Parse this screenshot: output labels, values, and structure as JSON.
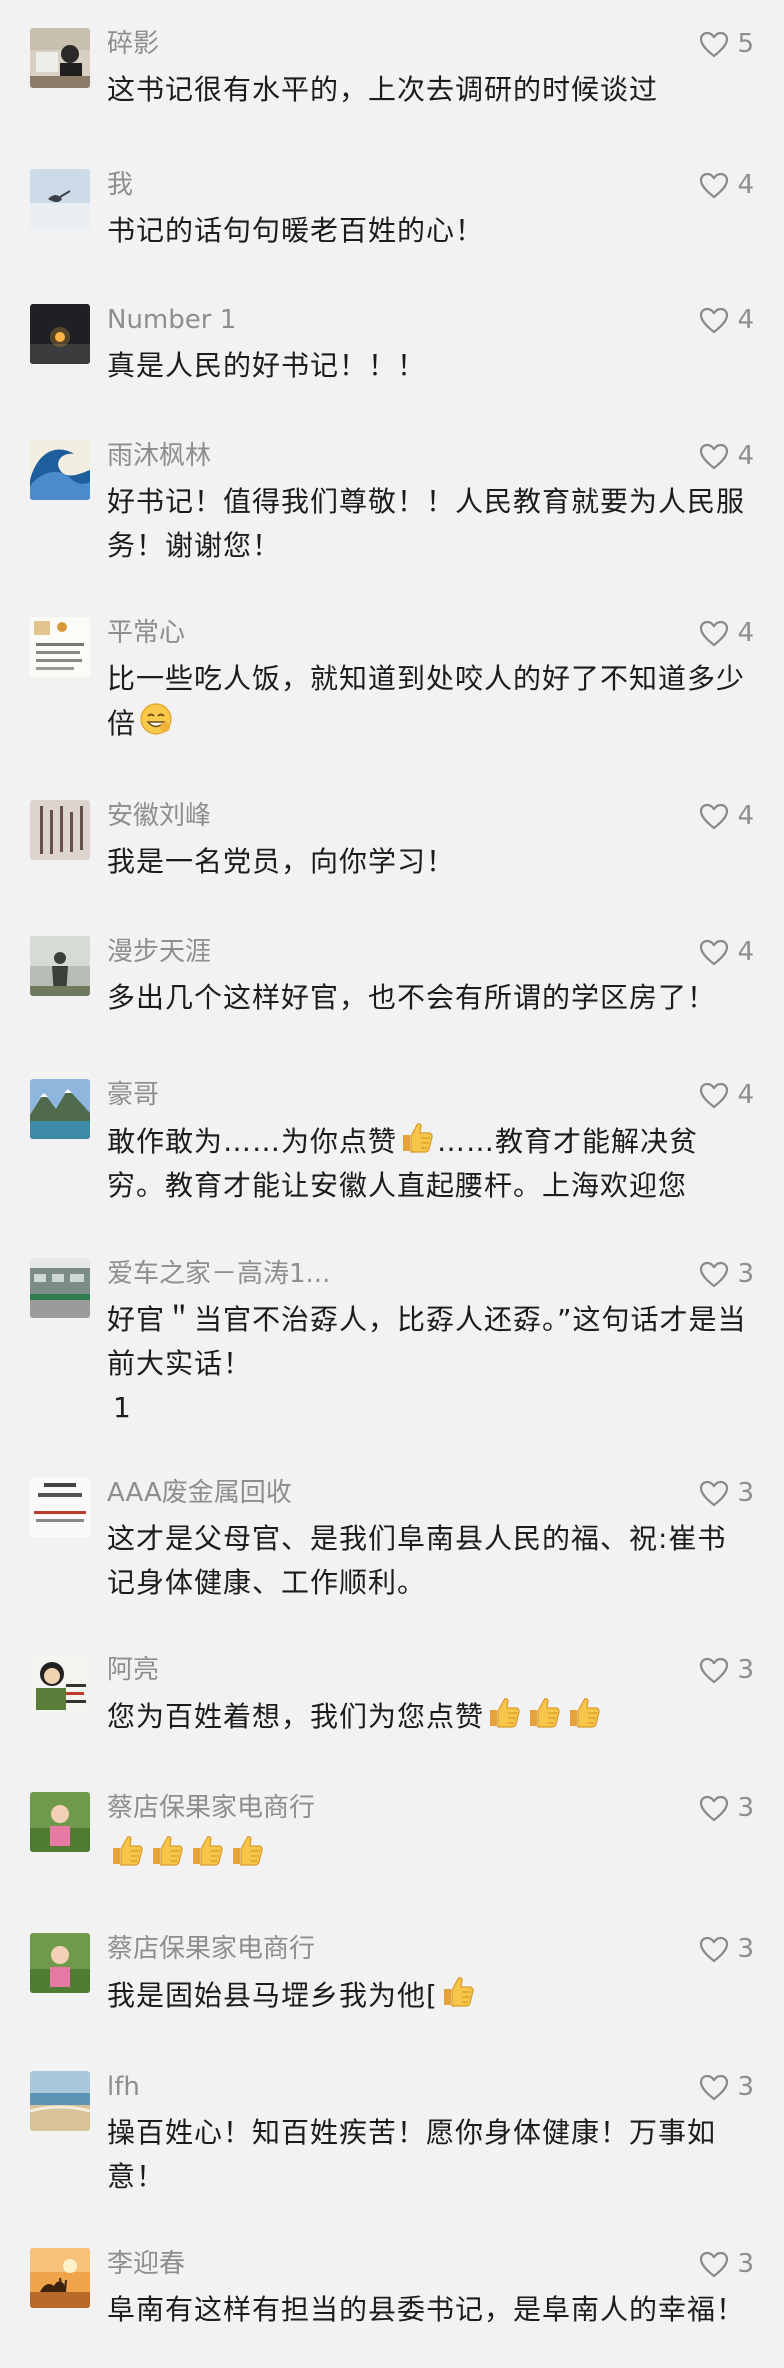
{
  "comments": [
    {
      "name": "碎影",
      "likes": "5",
      "text": "这书记很有水平的，上次去调研的时候谈过",
      "avatar": "avatar-photo-office"
    },
    {
      "name": "我",
      "likes": "4",
      "text": "书记的话句句暖老百姓的心！",
      "avatar": "avatar-sky-bird"
    },
    {
      "name": "Number 1",
      "likes": "4",
      "text": "真是人民的好书记！！！",
      "avatar": "avatar-dark-candle"
    },
    {
      "name": "雨沐枫林",
      "likes": "4",
      "text": "好书记！值得我们尊敬！！人民教育就要为人民服务！谢谢您！",
      "avatar": "avatar-wave"
    },
    {
      "name": "平常心",
      "likes": "4",
      "text": "比一些吃人饭，就知道到处咬人的好了不知道多少倍",
      "avatar": "avatar-text-card",
      "emoji": "grin-face-emoji"
    },
    {
      "name": "安徽刘峰",
      "likes": "4",
      "text": "我是一名党员，向你学习！",
      "avatar": "avatar-calligraphy"
    },
    {
      "name": "漫步天涯",
      "likes": "4",
      "text": "多出几个这样好官，也不会有所谓的学区房了！",
      "avatar": "avatar-person-silhouette"
    },
    {
      "name": "豪哥",
      "likes": "4",
      "text_parts": [
        "敢作敢为……为你点赞",
        "……教育才能解决贫穷。教育才能让安徽人直起腰杆。上海欢迎您"
      ],
      "avatar": "avatar-mountain-lake"
    },
    {
      "name": "爱车之家－高涛1...",
      "likes": "3",
      "text": "好官＂当官不治孬人，比孬人还孬。”这句话才是当前大实话！",
      "text_extra": "1",
      "avatar": "avatar-storefront"
    },
    {
      "name": "AAA废金属回收",
      "likes": "3",
      "text": "这才是父母官、是我们阜南县人民的福、祝:崔书记身体健康、工作顺利。",
      "avatar": "avatar-text-card-2"
    },
    {
      "name": "阿亮",
      "likes": "3",
      "text": "您为百姓着想，我们为您点赞",
      "thumbs_after": 3,
      "avatar": "avatar-cartoon"
    },
    {
      "name": "蔡店保果家电商行",
      "likes": "3",
      "text": "",
      "thumbs_after": 4,
      "avatar": "avatar-child-grass"
    },
    {
      "name": "蔡店保果家电商行",
      "likes": "3",
      "text": "我是固始县马堽乡我为他[",
      "thumbs_after": 1,
      "avatar": "avatar-child-grass"
    },
    {
      "name": "lfh",
      "likes": "3",
      "text": "操百姓心！知百姓疾苦！愿你身体健康！万事如意！",
      "avatar": "avatar-beach"
    },
    {
      "name": "李迎春",
      "likes": "3",
      "text": "阜南有这样有担当的县委书记，是阜南人的幸福！",
      "avatar": "avatar-camel-sunset"
    }
  ]
}
